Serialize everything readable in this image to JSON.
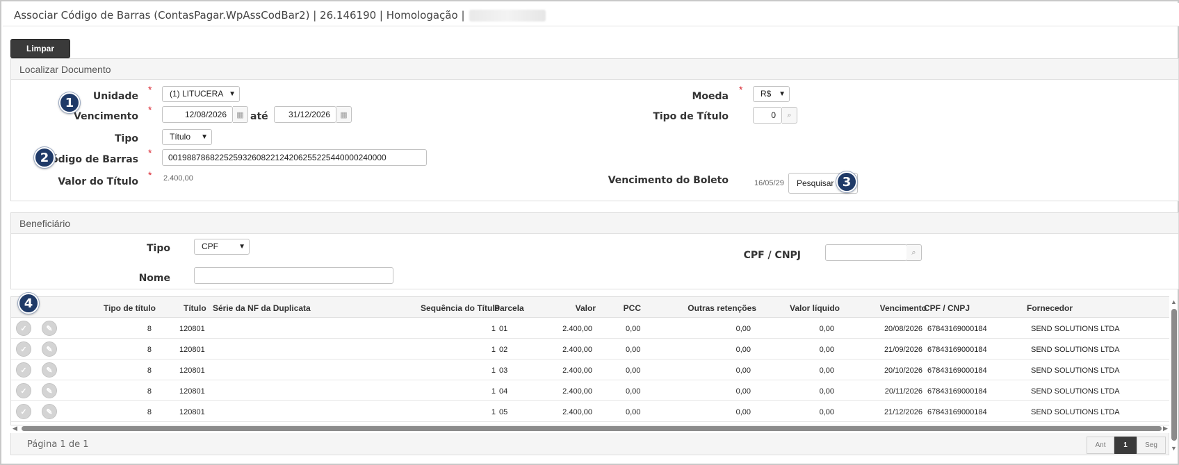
{
  "window": {
    "title": "Associar Código de Barras (ContasPagar.WpAssCodBar2) | 26.146190 | Homologação |"
  },
  "toolbar": {
    "limpar_label": "Limpar"
  },
  "localizar": {
    "header": "Localizar Documento",
    "unidade_label": "Unidade",
    "unidade_value": "(1) LITUCERA",
    "vencimento_label": "Vencimento",
    "venc_from": "12/08/2026",
    "ate_label": "até",
    "venc_to": "31/12/2026",
    "tipo_label": "Tipo",
    "tipo_value": "Título",
    "codigo_label": "Código de Barras",
    "codigo_value": "00198878682252593260822124206255225440000240000",
    "valor_label": "Valor do Título",
    "valor_value": "2.400,00",
    "moeda_label": "Moeda",
    "moeda_value": "R$",
    "tipo_titulo_label": "Tipo de Título",
    "tipo_titulo_value": "0",
    "venc_boleto_label": "Vencimento do Boleto",
    "venc_boleto_value": "16/05/29",
    "pesquisar_label": "Pesquisar",
    "required_mark": "*"
  },
  "beneficiario": {
    "header": "Beneficiário",
    "tipo_label": "Tipo",
    "tipo_value": "CPF",
    "nome_label": "Nome",
    "nome_value": "",
    "cpf_label": "CPF / CNPJ",
    "cpf_value": ""
  },
  "badges": [
    "1",
    "2",
    "3",
    "4"
  ],
  "table": {
    "columns": [
      "Tipo de título",
      "Título",
      "Série da NF da Duplicata",
      "Sequência do Título",
      "Parcela",
      "Valor",
      "PCC",
      "Outras retenções",
      "Valor líquido",
      "Vencimento",
      "CPF / CNPJ",
      "Fornecedor"
    ],
    "rows": [
      [
        "8",
        "120801",
        "",
        "1",
        "01",
        "2.400,00",
        "0,00",
        "0,00",
        "0,00",
        "20/08/2026",
        "67843169000184",
        "SEND SOLUTIONS LTDA"
      ],
      [
        "8",
        "120801",
        "",
        "1",
        "02",
        "2.400,00",
        "0,00",
        "0,00",
        "0,00",
        "21/09/2026",
        "67843169000184",
        "SEND SOLUTIONS LTDA"
      ],
      [
        "8",
        "120801",
        "",
        "1",
        "03",
        "2.400,00",
        "0,00",
        "0,00",
        "0,00",
        "20/10/2026",
        "67843169000184",
        "SEND SOLUTIONS LTDA"
      ],
      [
        "8",
        "120801",
        "",
        "1",
        "04",
        "2.400,00",
        "0,00",
        "0,00",
        "0,00",
        "20/11/2026",
        "67843169000184",
        "SEND SOLUTIONS LTDA"
      ],
      [
        "8",
        "120801",
        "",
        "1",
        "05",
        "2.400,00",
        "0,00",
        "0,00",
        "0,00",
        "21/12/2026",
        "67843169000184",
        "SEND SOLUTIONS LTDA"
      ]
    ]
  },
  "pagination": {
    "info": "Página 1 de 1",
    "prev_label": "Ant",
    "current_page": "1",
    "next_label": "Seg"
  }
}
